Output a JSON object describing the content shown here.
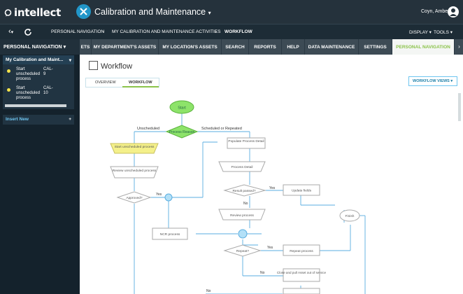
{
  "app": {
    "logo": "intellect",
    "title": "Calibration and Maintenance",
    "user": "Coyn, Amber"
  },
  "breadcrumb": [
    "PERSONAL NAVIGATION",
    "MY CALIBRATION AND MAINTENANCE ACTIVITIES",
    "WORKFLOW"
  ],
  "nav_right": {
    "display": "DISPLAY",
    "tools": "TOOLS"
  },
  "sidebar": {
    "header": "PERSONAL NAVIGATION",
    "panel_title": "My Calibration and Maint...",
    "items": [
      {
        "label": "Start unscheduled process",
        "code": "CAL-9"
      },
      {
        "label": "Start unscheduled process",
        "code": "CAL-10"
      }
    ],
    "insert_new": "Insert New"
  },
  "tabs": [
    "ETS",
    "MY DEPARTMENT'S ASSETS",
    "MY LOCATION'S ASSETS",
    "SEARCH",
    "REPORTS",
    "HELP",
    "DATA MAINTENANCE",
    "SETTINGS",
    "PERSONAL NAVIGATION"
  ],
  "page": {
    "title": "Workflow",
    "subtabs": [
      "OVERVIEW",
      "WORKFLOW"
    ],
    "views_button": "WORKFLOW VIEWS"
  },
  "flow": {
    "start": "Start",
    "process_reason": "Process Reason",
    "unscheduled": "Unscheduled",
    "scheduled": "Scheduled or Repeated",
    "start_unscheduled": "Start unscheduled process",
    "populate": "Populate Process Detail",
    "review_unscheduled": "Review unscheduled process",
    "process_detail": "Process Detail",
    "approved": "Approved?",
    "yes": "Yes",
    "no": "No",
    "result_passed": "Result passed?",
    "update_fields": "Update fields",
    "review_process": "Review process",
    "finish": "Finish",
    "ncr_process": "NCR process",
    "repeat": "Repeat?",
    "repeat_process": "Repeat process",
    "close_pull": "Close and pull Asset out of service"
  },
  "colors": {
    "accent": "#8bc34a",
    "link": "#2196c9",
    "start": "#8de36a",
    "highlight": "#f4f08a"
  }
}
